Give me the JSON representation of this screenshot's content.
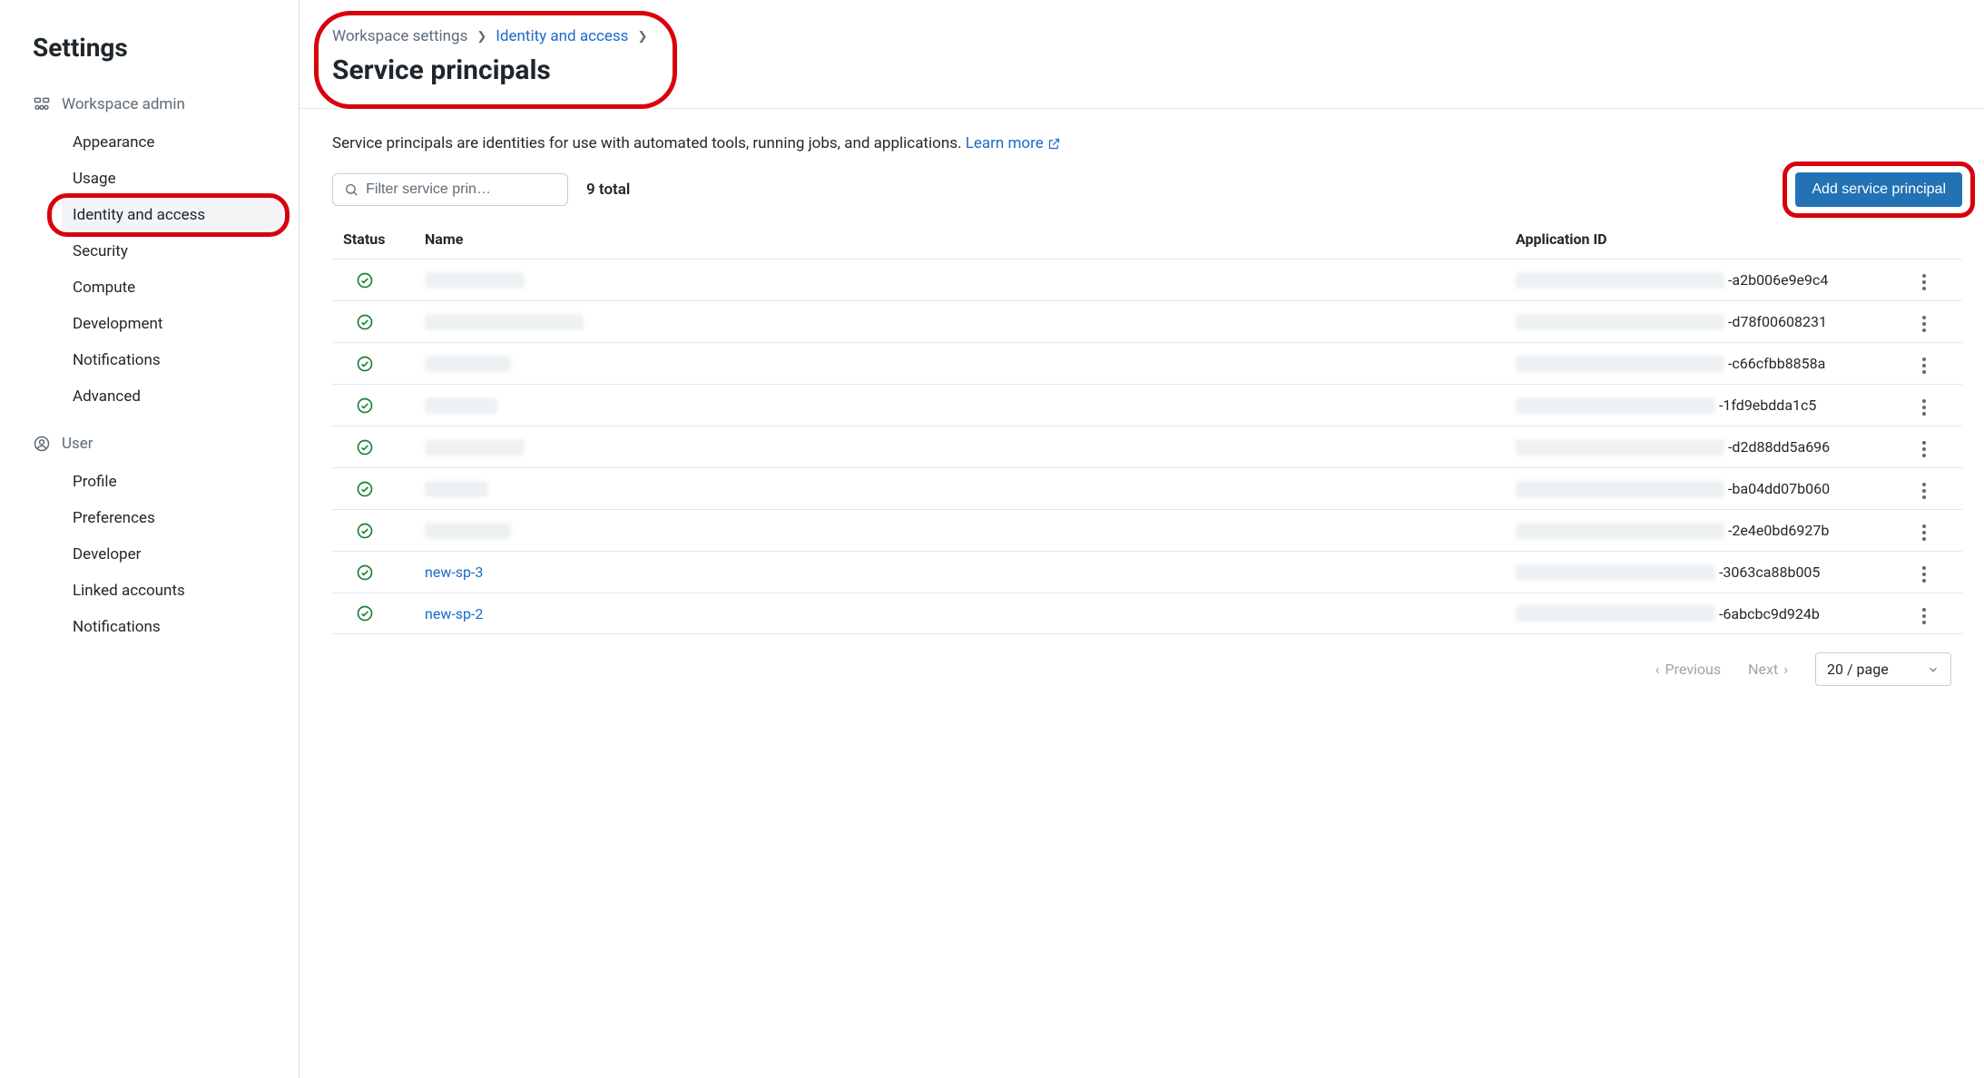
{
  "sidebar": {
    "title": "Settings",
    "sections": [
      {
        "label": "Workspace admin",
        "items": [
          {
            "label": "Appearance",
            "selected": false
          },
          {
            "label": "Usage",
            "selected": false
          },
          {
            "label": "Identity and access",
            "selected": true,
            "highlighted": true
          },
          {
            "label": "Security",
            "selected": false
          },
          {
            "label": "Compute",
            "selected": false
          },
          {
            "label": "Development",
            "selected": false
          },
          {
            "label": "Notifications",
            "selected": false
          },
          {
            "label": "Advanced",
            "selected": false
          }
        ]
      },
      {
        "label": "User",
        "items": [
          {
            "label": "Profile",
            "selected": false
          },
          {
            "label": "Preferences",
            "selected": false
          },
          {
            "label": "Developer",
            "selected": false
          },
          {
            "label": "Linked accounts",
            "selected": false
          },
          {
            "label": "Notifications",
            "selected": false
          }
        ]
      }
    ]
  },
  "header": {
    "breadcrumb": [
      {
        "label": "Workspace settings",
        "link": false
      },
      {
        "label": "Identity and access",
        "link": true
      }
    ],
    "title": "Service principals",
    "highlighted": true
  },
  "description": {
    "text": "Service principals are identities for use with automated tools, running jobs, and applications. ",
    "learn_more": "Learn more"
  },
  "toolbar": {
    "filter_placeholder": "Filter service prin…",
    "total_label": "9 total",
    "add_button": "Add service principal",
    "add_highlighted": true
  },
  "table": {
    "columns": {
      "status": "Status",
      "name": "Name",
      "appid": "Application ID"
    },
    "rows": [
      {
        "name": "",
        "name_redacted": true,
        "name_blur_w": 110,
        "appid_suffix": "-a2b006e9e9c4",
        "appid_blur_w": 230
      },
      {
        "name": "",
        "name_redacted": true,
        "name_blur_w": 175,
        "appid_suffix": "-d78f00608231",
        "appid_blur_w": 230
      },
      {
        "name": "",
        "name_redacted": true,
        "name_blur_w": 95,
        "appid_suffix": "-c66cfbb8858a",
        "appid_blur_w": 230
      },
      {
        "name": "",
        "name_redacted": true,
        "name_blur_w": 80,
        "appid_suffix": "-1fd9ebdda1c5",
        "appid_blur_w": 220
      },
      {
        "name": "",
        "name_redacted": true,
        "name_blur_w": 110,
        "appid_suffix": "-d2d88dd5a696",
        "appid_blur_w": 230
      },
      {
        "name": "",
        "name_redacted": true,
        "name_blur_w": 70,
        "appid_suffix": "-ba04dd07b060",
        "appid_blur_w": 230
      },
      {
        "name": "",
        "name_redacted": true,
        "name_blur_w": 95,
        "appid_suffix": "-2e4e0bd6927b",
        "appid_blur_w": 230
      },
      {
        "name": "new-sp-3",
        "name_redacted": false,
        "appid_suffix": "-3063ca88b005",
        "appid_blur_w": 220
      },
      {
        "name": "new-sp-2",
        "name_redacted": false,
        "appid_suffix": "-6abcbc9d924b",
        "appid_blur_w": 220
      }
    ]
  },
  "pagination": {
    "prev": "Previous",
    "next": "Next",
    "page_size": "20 / page"
  }
}
